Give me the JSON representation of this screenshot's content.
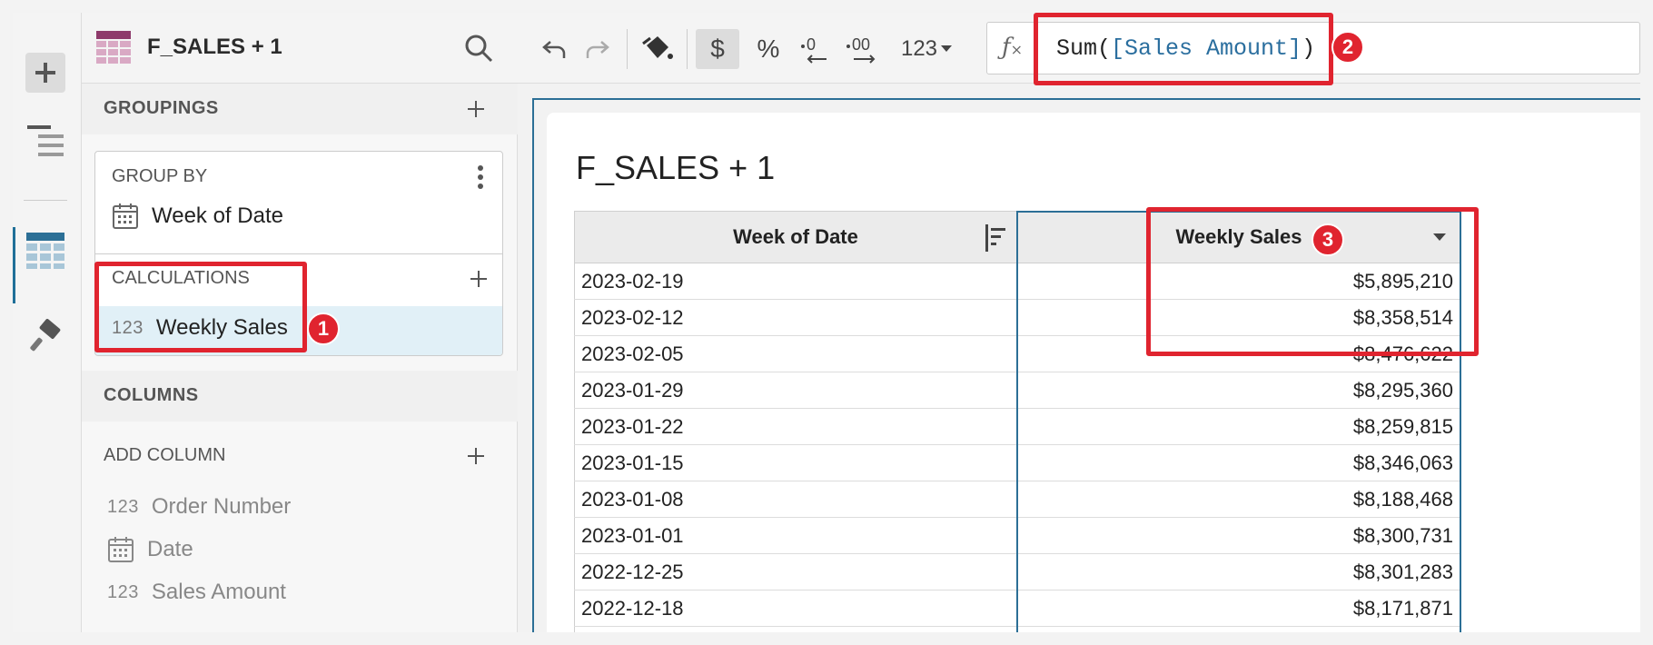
{
  "panel": {
    "title": "F_SALES + 1",
    "groupings_label": "GROUPINGS",
    "group_by_label": "GROUP BY",
    "group_item": "Week of Date",
    "calculations_label": "CALCULATIONS",
    "calc_item_type": "123",
    "calc_item": "Weekly Sales",
    "columns_label": "COLUMNS",
    "add_column_label": "ADD COLUMN",
    "columns": [
      {
        "type": "123",
        "name": "Order Number",
        "icon": "number-icon"
      },
      {
        "type": "",
        "name": "Date",
        "icon": "calendar-icon"
      },
      {
        "type": "123",
        "name": "Sales Amount",
        "icon": "number-icon"
      }
    ]
  },
  "toolbar": {
    "currency": "$",
    "percent": "%",
    "number_format": "123",
    "formula_prefix": "Sum(",
    "formula_ref": "[Sales Amount]",
    "formula_suffix": ")"
  },
  "element": {
    "title": "F_SALES + 1",
    "columns": [
      "Week of Date",
      "Weekly Sales"
    ],
    "rows": [
      {
        "date": "2023-02-19",
        "value": "$5,895,210"
      },
      {
        "date": "2023-02-12",
        "value": "$8,358,514"
      },
      {
        "date": "2023-02-05",
        "value": "$8,476,622"
      },
      {
        "date": "2023-01-29",
        "value": "$8,295,360"
      },
      {
        "date": "2023-01-22",
        "value": "$8,259,815"
      },
      {
        "date": "2023-01-15",
        "value": "$8,346,063"
      },
      {
        "date": "2023-01-08",
        "value": "$8,188,468"
      },
      {
        "date": "2023-01-01",
        "value": "$8,300,731"
      },
      {
        "date": "2022-12-25",
        "value": "$8,301,283"
      },
      {
        "date": "2022-12-18",
        "value": "$8,171,871"
      }
    ]
  },
  "annotations": [
    "1",
    "2",
    "3"
  ],
  "colors": {
    "accent": "#2c6f96",
    "highlight": "#e0242f",
    "selected_row": "#e1f0f7"
  }
}
